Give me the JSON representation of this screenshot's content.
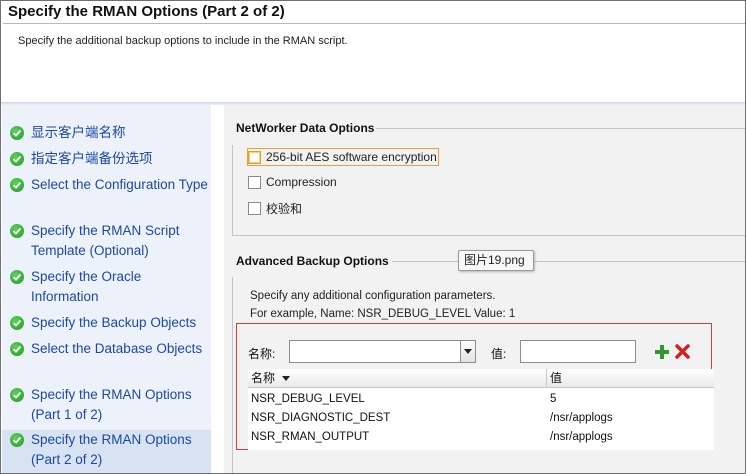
{
  "header": {
    "title": "Specify the RMAN Options (Part 2 of 2)",
    "subtitle": "Specify the additional backup options to include in the RMAN script."
  },
  "sidebar": {
    "steps": [
      {
        "label": "显示客户端名称"
      },
      {
        "label": "指定客户端备份选项"
      },
      {
        "label": "Select the Configuration Type"
      },
      {
        "label": "Specify the RMAN Script Template (Optional)"
      },
      {
        "label": "Specify the Oracle Information"
      },
      {
        "label": "Specify the Backup Objects"
      },
      {
        "label": "Select the Database Objects"
      },
      {
        "label": "Specify the RMAN Options (Part 1 of 2)"
      },
      {
        "label": "Specify the RMAN Options (Part 2 of 2)"
      }
    ]
  },
  "networker": {
    "title": "NetWorker Data Options",
    "options": [
      {
        "label": "256-bit AES software encryption",
        "checked": false
      },
      {
        "label": "Compression",
        "checked": false
      },
      {
        "label": "校验和",
        "checked": false
      }
    ]
  },
  "advanced": {
    "title": "Advanced Backup Options",
    "help1": "Specify any additional configuration parameters.",
    "help2": "For example, Name: NSR_DEBUG_LEVEL Value: 1",
    "name_label": "名称:",
    "name_value": "",
    "value_label": "值:",
    "value_value": "",
    "table": {
      "columns": [
        "名称",
        "值"
      ],
      "rows": [
        [
          "NSR_DEBUG_LEVEL",
          "5"
        ],
        [
          "NSR_DIAGNOSTIC_DEST",
          "/nsr/applogs"
        ],
        [
          "NSR_RMAN_OUTPUT",
          "/nsr/applogs"
        ]
      ]
    }
  },
  "tooltip": {
    "text": "图片19.png"
  },
  "colors": {
    "check_green": "#1f9a1f",
    "link_blue": "#1a4aa6",
    "highlight_red": "#d93a3a",
    "add_green": "#2e9a2e",
    "remove_red": "#d42020"
  }
}
